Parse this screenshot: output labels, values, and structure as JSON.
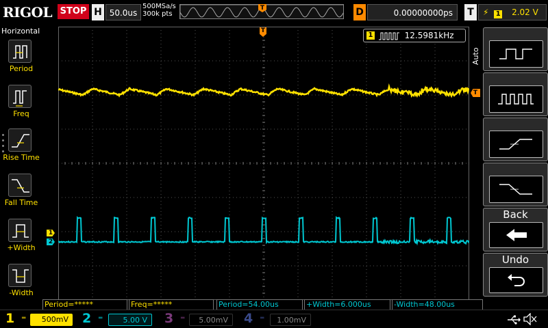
{
  "header": {
    "logo": "RIGOL",
    "run_state": "STOP",
    "horizontal_letter": "H",
    "timebase": "50.0us",
    "sample_rate": "500MSa/s",
    "memory_depth": "300k pts",
    "trigger_pos_letter": "T",
    "delay_letter": "D",
    "delay": "0.00000000ps",
    "trigger_letter": "T",
    "trigger_edge": "rising-edge-icon",
    "trigger_channel": "1",
    "trigger_level": "2.02 V"
  },
  "left_menu": {
    "title": "Horizontal",
    "items": [
      {
        "label": "Period",
        "icon": "period-icon"
      },
      {
        "label": "Freq",
        "icon": "frequency-icon"
      },
      {
        "label": "Rise Time",
        "icon": "rise-time-icon"
      },
      {
        "label": "Fall Time",
        "icon": "fall-time-icon"
      },
      {
        "label": "+Width",
        "icon": "positive-width-icon"
      },
      {
        "label": "-Width",
        "icon": "negative-width-icon"
      }
    ]
  },
  "screen": {
    "trigger_marker": "T",
    "trigger_level_marker": "T",
    "ch1_marker": "1",
    "ch2_marker": "2",
    "freq_counter": {
      "channel": "1",
      "value": "12.5981kHz"
    }
  },
  "right_menu": {
    "auto_label": "Auto",
    "buttons": [
      {
        "icon": "wide-pulse-icon"
      },
      {
        "icon": "narrow-pulse-train-icon"
      },
      {
        "icon": "rising-edge-icon"
      },
      {
        "icon": "falling-edge-icon"
      },
      {
        "label": "Back",
        "icon": "back-arrow-icon"
      },
      {
        "label": "Undo",
        "icon": "undo-icon"
      }
    ]
  },
  "measurements": [
    {
      "text": "Period=*****",
      "color": "#ffe100"
    },
    {
      "text": "Freq=*****",
      "color": "#ffe100"
    },
    {
      "text": "Period=54.00us",
      "color": "#00c8d2"
    },
    {
      "text": "+Width=6.000us",
      "color": "#00c8d2"
    },
    {
      "text": "-Width=48.00us",
      "color": "#00c8d2"
    }
  ],
  "channels": [
    {
      "num": "1",
      "scale": "500mV",
      "coupling": "═",
      "color": "#ffe100",
      "active": true
    },
    {
      "num": "2",
      "scale": "5.00 V",
      "coupling": "═",
      "color": "#00c8d2",
      "active": true
    },
    {
      "num": "3",
      "scale": "5.00mV",
      "coupling": "═",
      "color": "#c040c0",
      "active": false
    },
    {
      "num": "4",
      "scale": "1.00mV",
      "coupling": "═",
      "color": "#4060ff",
      "active": false
    }
  ],
  "status_icons": [
    "usb-icon",
    "speaker-muted-icon"
  ],
  "colors": {
    "ch1": "#ffe100",
    "ch2": "#00c8d2",
    "trigger": "#ff8a00",
    "stop": "#d0021b"
  }
}
